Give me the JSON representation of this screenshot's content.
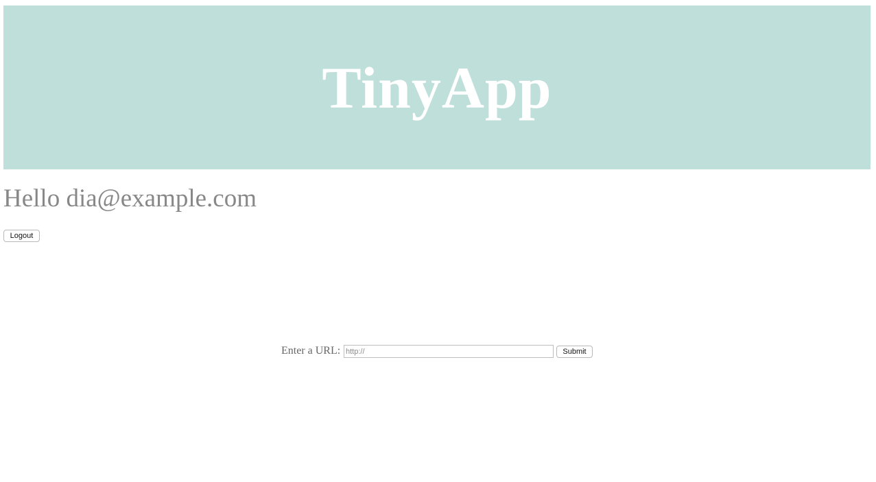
{
  "header": {
    "title": "TinyApp",
    "background_color": "#bfdfda",
    "title_color": "#ffffff"
  },
  "user": {
    "greeting": "Hello dia@example.com",
    "logout_label": "Logout"
  },
  "url_form": {
    "label": "Enter a URL:",
    "input_placeholder": "http://",
    "input_value": "",
    "submit_label": "Submit"
  }
}
